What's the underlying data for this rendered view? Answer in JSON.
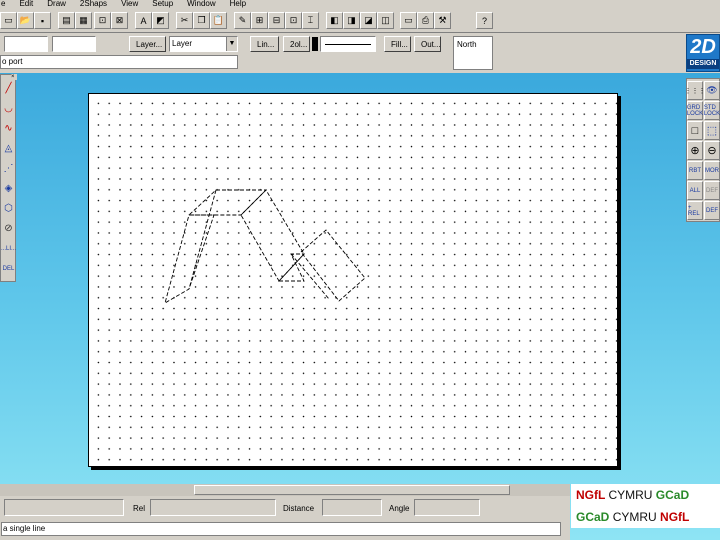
{
  "menu": [
    "e",
    "Edit",
    "Draw",
    "2Shaps",
    "View",
    "Setup",
    "Window",
    "Help"
  ],
  "toolbar": {
    "layer_button": "Layer...",
    "layer_select": "Layer",
    "line_button": "Lin...",
    "fill_button": "Fill...",
    "outline_button": "Out...",
    "style_button": "2ol..."
  },
  "hint": "o port",
  "north_label": "North",
  "logo": {
    "big": "2D",
    "small": "DESIGN"
  },
  "left_tools": [
    "╱",
    "◡",
    "∿",
    "◬",
    "⋰",
    "◈",
    "⬡",
    "⊘"
  ],
  "left_tool_labels": [
    "...LI...",
    "DEL"
  ],
  "right_tools": [
    "⋮⋮⋮",
    "👁",
    "GRD LOCK",
    "STD LOCK",
    "□",
    "⬚",
    "⊕",
    "⊖",
    "RBT",
    "MOR",
    "ALL",
    "DEF",
    "+ REL",
    "DEF"
  ],
  "status": {
    "rel": "Rel",
    "distance": "Distance",
    "angle": "Angle"
  },
  "bottom_text": "a single line",
  "badge1": {
    "a": "NGfL",
    "b": "CYMRU",
    "c": "GCaD"
  },
  "badge2": {
    "a": "GCaD",
    "b": "CYMRU",
    "c": "NGfL"
  },
  "colors": {
    "desktop_top": "#2f9fd8",
    "desktop_bottom": "#8ee4f4",
    "chrome": "#d4d0c8"
  }
}
